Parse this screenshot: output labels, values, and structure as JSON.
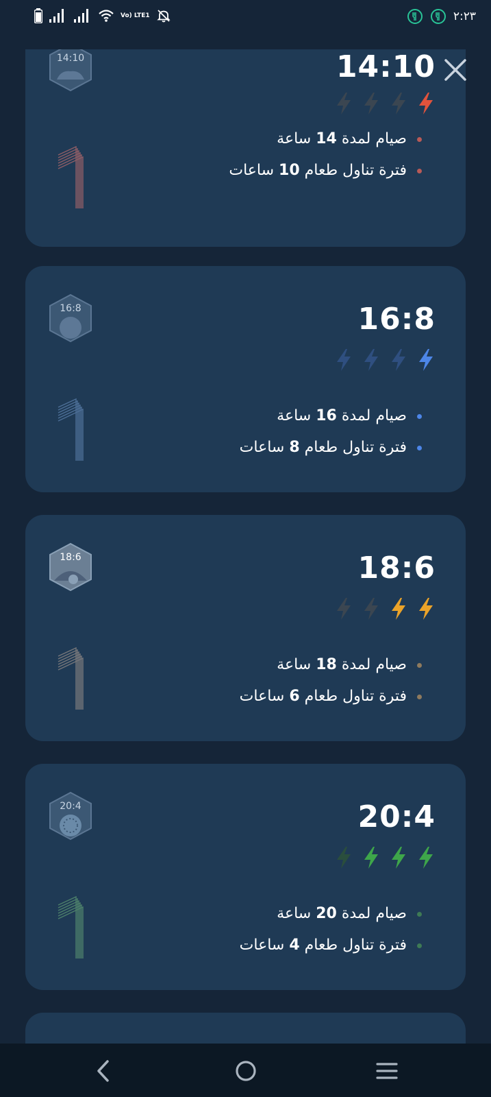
{
  "status_bar": {
    "volte_label": "Vo) LTE1",
    "time": "٢:٢٣",
    "left_icons": [
      "battery-icon",
      "signal-1-icon",
      "signal-2-icon",
      "wifi-icon",
      "volte-icon",
      "mute-notifications-icon"
    ],
    "right_icons": [
      "fasting-status-icon",
      "fasting-status-icon",
      "time"
    ]
  },
  "colors": {
    "background": "#152538",
    "card": "#1f3a55",
    "plan_14_10": "#e2533c",
    "plan_16_8": "#4d86e8",
    "plan_18_6": "#eba329",
    "plan_20_4": "#3ea64a",
    "bolt_inactive": "#3b4651"
  },
  "plans": [
    {
      "ratio": "14:10",
      "badge": "14:10",
      "active_bolts": 1,
      "fast_prefix": "صيام لمدة",
      "fast_hours": "14",
      "fast_unit": "ساعة",
      "eat_prefix": "فترة تناول طعام",
      "eat_hours": "10",
      "eat_unit": "ساعات"
    },
    {
      "ratio": "16:8",
      "badge": "16:8",
      "active_bolts": 1,
      "fast_prefix": "صيام لمدة",
      "fast_hours": "16",
      "fast_unit": "ساعة",
      "eat_prefix": "فترة تناول طعام",
      "eat_hours": "8",
      "eat_unit": "ساعات"
    },
    {
      "ratio": "18:6",
      "badge": "18:6",
      "active_bolts": 2,
      "fast_prefix": "صيام لمدة",
      "fast_hours": "18",
      "fast_unit": "ساعة",
      "eat_prefix": "فترة تناول طعام",
      "eat_hours": "6",
      "eat_unit": "ساعات"
    },
    {
      "ratio": "20:4",
      "badge": "20:4",
      "active_bolts": 3,
      "fast_prefix": "صيام لمدة",
      "fast_hours": "20",
      "fast_unit": "ساعة",
      "eat_prefix": "فترة تناول طعام",
      "eat_hours": "4",
      "eat_unit": "ساعات"
    }
  ],
  "nav": {
    "icons": [
      "back-icon",
      "home-icon",
      "menu-icon"
    ]
  }
}
